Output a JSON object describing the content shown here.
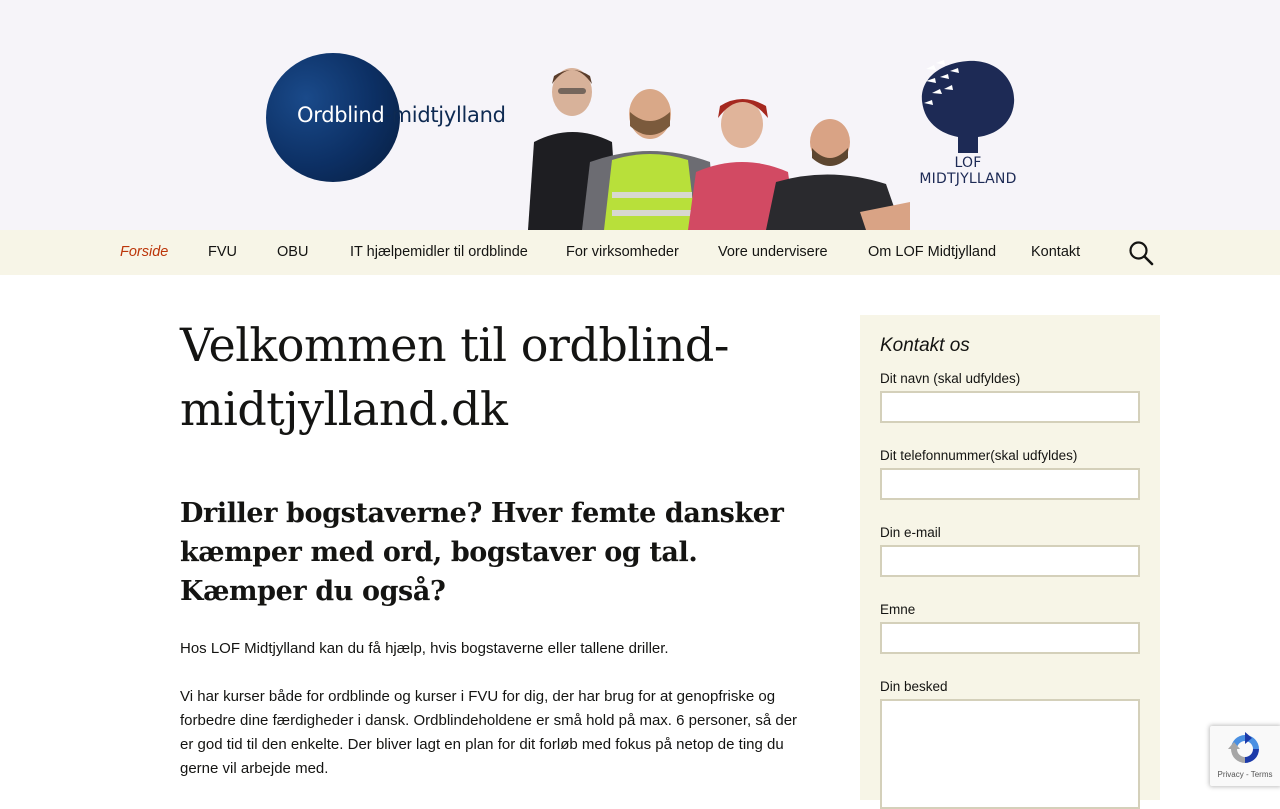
{
  "header": {
    "logo_text_main": "Ordblind",
    "logo_text_rest": "-midtjylland",
    "org_logo_line1": "LOF",
    "org_logo_line2": "MIDTJYLLAND"
  },
  "nav": {
    "items": [
      {
        "label": "Forside"
      },
      {
        "label": "FVU"
      },
      {
        "label": "OBU"
      },
      {
        "label": "IT hjælpemidler til ordblinde"
      },
      {
        "label": "For virksomheder"
      },
      {
        "label": "Vore undervisere"
      },
      {
        "label": "Om LOF Midtjylland"
      },
      {
        "label": "Kontakt"
      }
    ],
    "active_color": "#bc360a",
    "background": "#f7f5e7"
  },
  "main": {
    "title": "Velkommen til ordblind-midtjylland.dk",
    "lead_heading": "Driller bogstaverne? Hver femte dansker kæmper med ord, bogstaver og tal. Kæmper du også?",
    "paragraphs": [
      "Hos LOF Midtjylland kan du få hjælp, hvis bogstaverne eller tallene driller.",
      "Vi har kurser både for ordblinde og kurser i FVU for dig, der har brug for at genopfriske og forbedre dine færdigheder i dansk. Ordblindeholdene er små hold på max. 6 personer, så der er god tid til den enkelte. Der bliver lagt en plan for dit forløb med fokus på netop de ting du gerne vil arbejde med."
    ]
  },
  "sidebar": {
    "title": "Kontakt os",
    "fields": [
      {
        "label": "Dit navn (skal udfyldes)",
        "value": ""
      },
      {
        "label": "Dit telefonnummer(skal udfyldes)",
        "value": ""
      },
      {
        "label": "Din e-mail",
        "value": ""
      },
      {
        "label": "Emne",
        "value": ""
      },
      {
        "label": "Din besked",
        "value": ""
      }
    ]
  },
  "recaptcha": {
    "links": "Privacy - Terms"
  }
}
